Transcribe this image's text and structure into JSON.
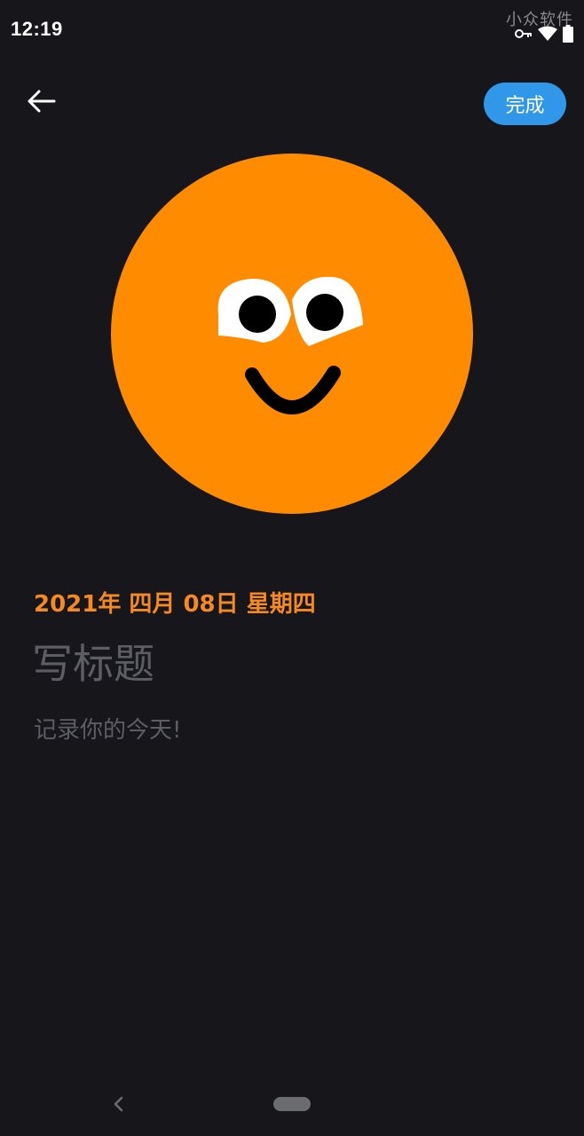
{
  "status_bar": {
    "time": "12:19",
    "watermark": "小众软件",
    "icons": [
      "vpn-key-icon",
      "wifi-icon",
      "battery-icon"
    ]
  },
  "header": {
    "back_icon": "arrow-left-icon",
    "done_label": "完成"
  },
  "mood": {
    "icon": "smiling-face-icon",
    "color": "#ff8c00"
  },
  "entry": {
    "date": "2021年 四月 08日 星期四",
    "title_placeholder": "写标题",
    "body_placeholder": "记录你的今天!"
  },
  "colors": {
    "background": "#16161b",
    "accent": "#f58a22",
    "button": "#3197e8",
    "placeholder": "#5d5e63"
  },
  "nav_bar": {
    "back_icon": "chevron-left-icon",
    "home_icon": "home-pill-icon"
  }
}
